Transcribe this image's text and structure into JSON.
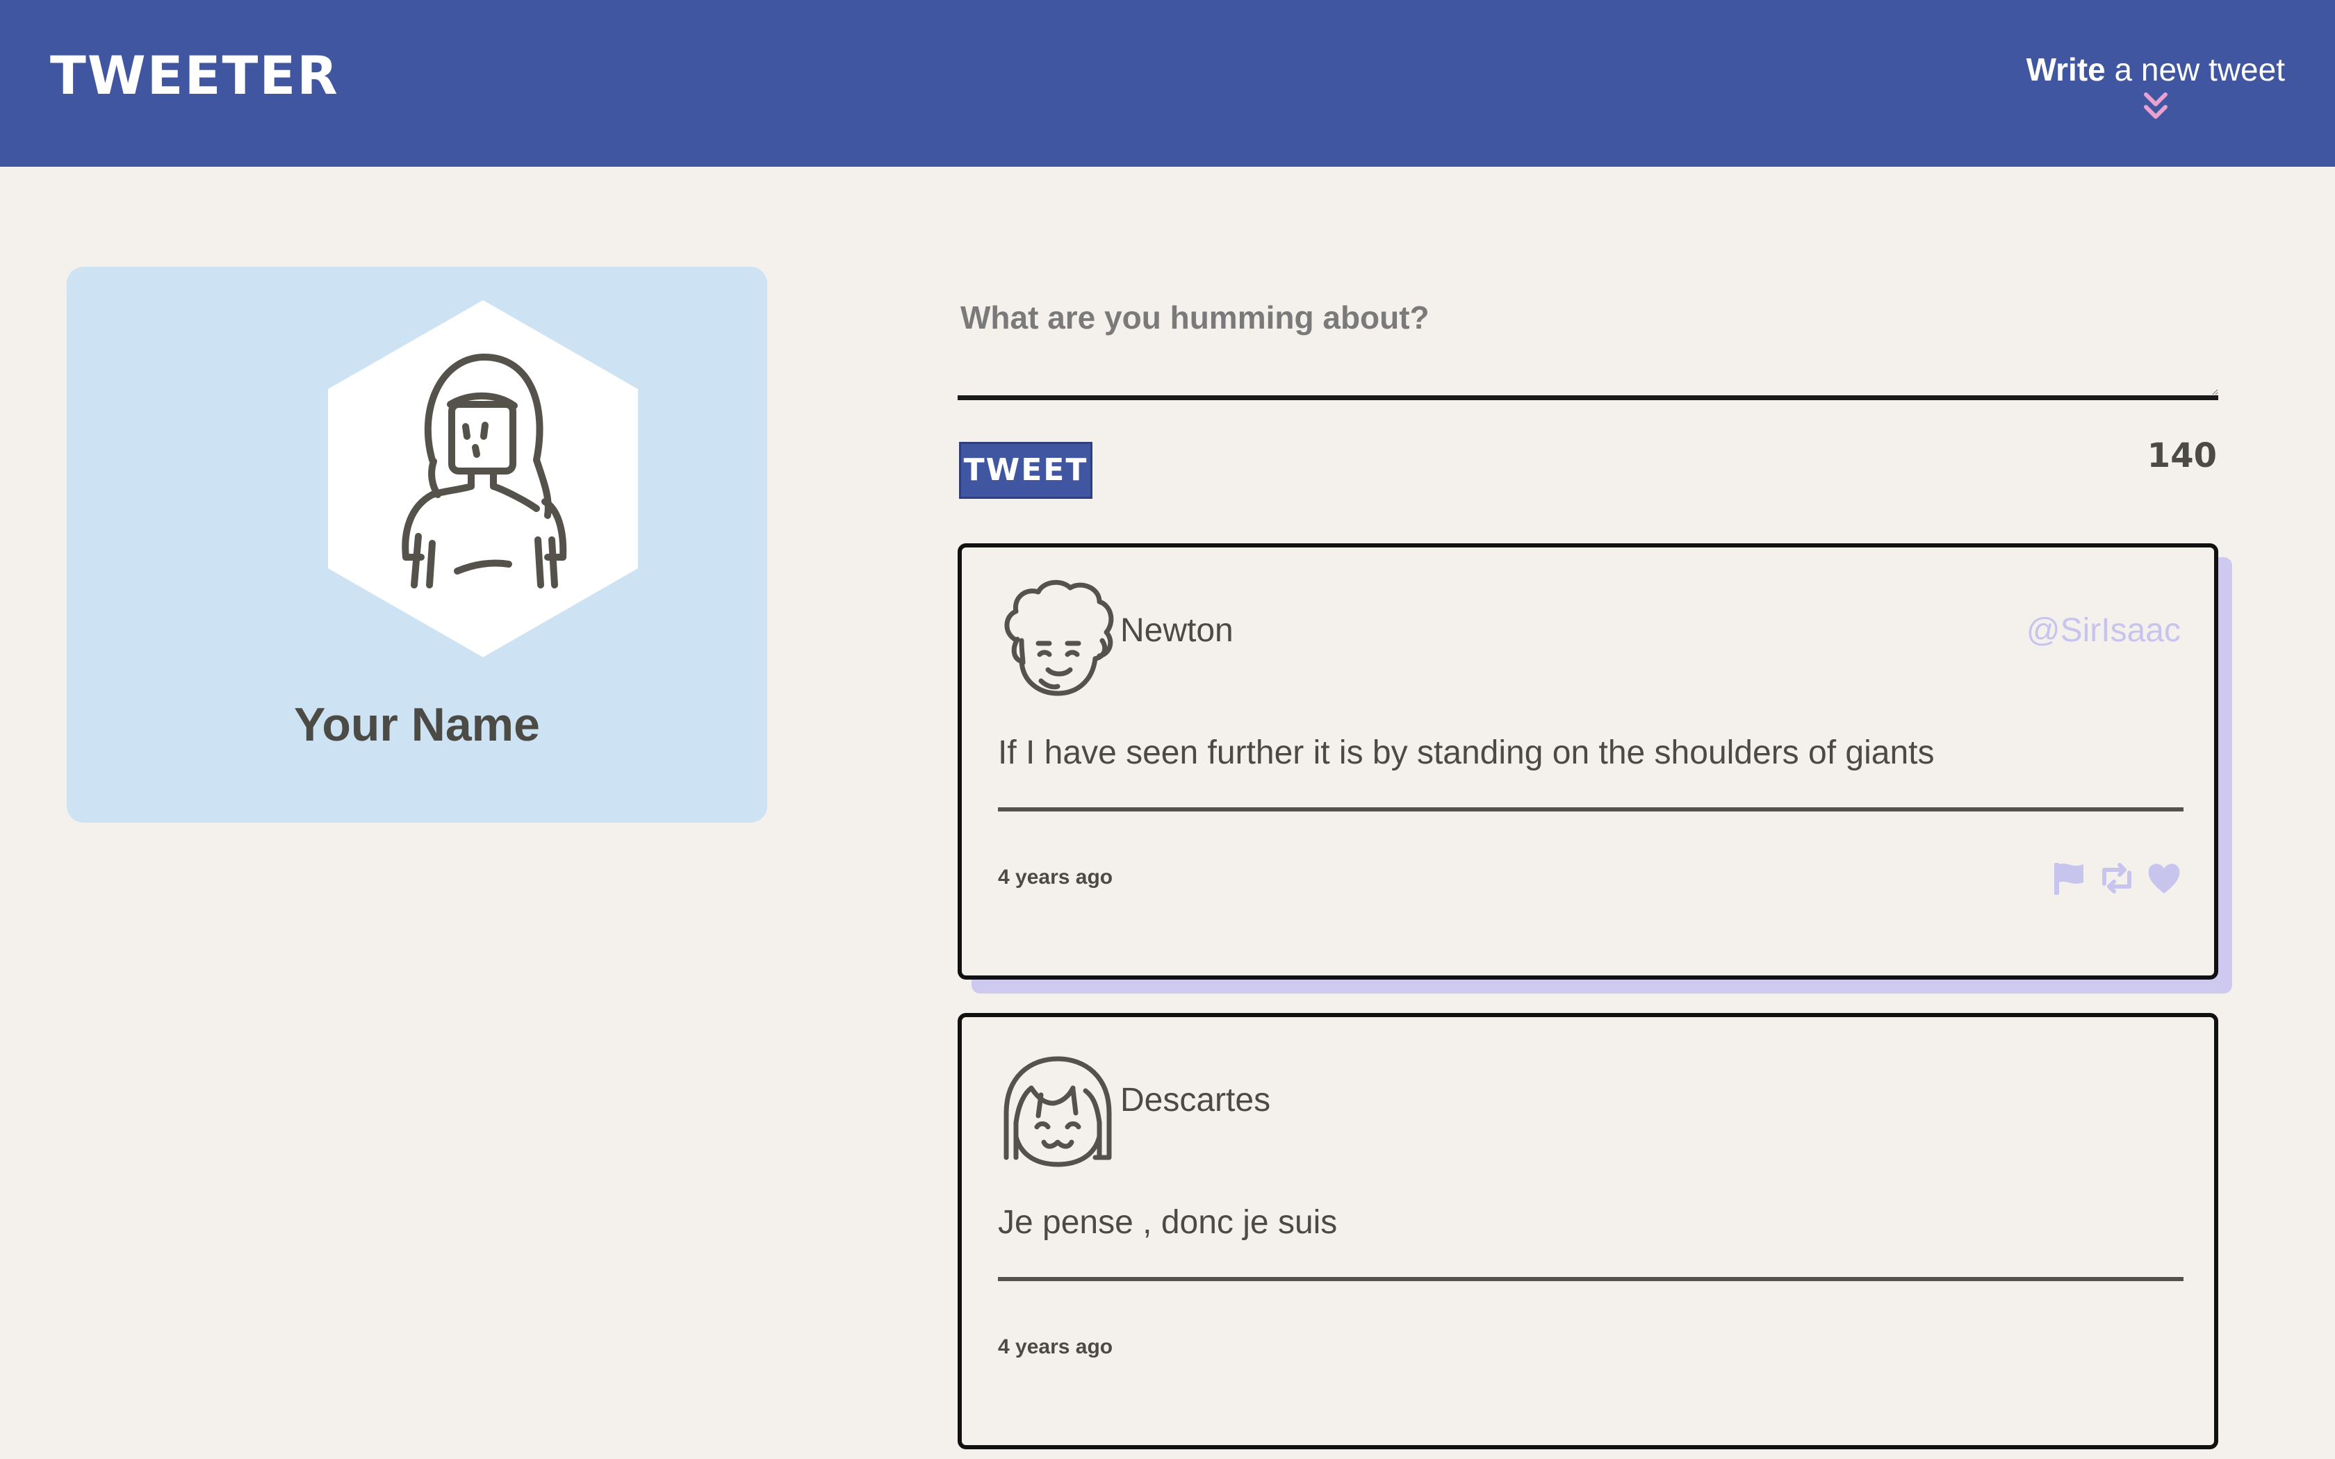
{
  "header": {
    "logo": "TWEETER",
    "compose_bold": "Write",
    "compose_rest": " a new tweet"
  },
  "profile": {
    "name": "Your Name"
  },
  "composer": {
    "placeholder": "What are you humming about?",
    "submit_label": "TWEET",
    "counter": "140"
  },
  "tweets": [
    {
      "author": "Newton",
      "handle": "@SirIsaac",
      "text": "If I have seen further it is by standing on the shoulders of giants",
      "time": "4 years ago",
      "actions": [
        "flag-icon",
        "retweet-icon",
        "heart-icon"
      ]
    },
    {
      "author": "Descartes",
      "text": "Je pense , donc je suis",
      "time": "4 years ago"
    }
  ],
  "colors": {
    "nav": "#4056a1",
    "page_bg": "#f4f1ec",
    "profile_bg": "#cde2f2",
    "accent": "#c7c4ed",
    "text": "#4b4a45",
    "chevron": "#e9a2d0"
  }
}
